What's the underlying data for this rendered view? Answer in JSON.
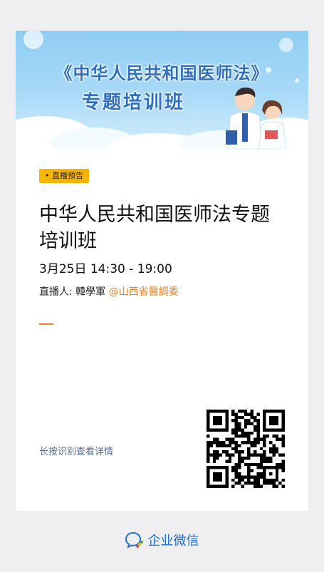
{
  "banner": {
    "title_line1": "《中华人民共和国医师法》",
    "title_line2": "专题培训班"
  },
  "badge": "• 直播预告",
  "live": {
    "title": "中华人民共和国医师法专题培训班",
    "time": "3月25日 14:30 - 19:00",
    "host_label": "直播人: ",
    "host_name": "韓學軍",
    "host_org": "@山西省醫調委"
  },
  "hint": "长按识别查看详情",
  "footer": {
    "brand": "企业微信",
    "icon": "wecom-logo-icon"
  },
  "colors": {
    "accent_orange": "#e8852b",
    "badge_yellow": "#f4b400",
    "brand_blue": "#1e6fd8",
    "link_gray_blue": "#576b95"
  }
}
